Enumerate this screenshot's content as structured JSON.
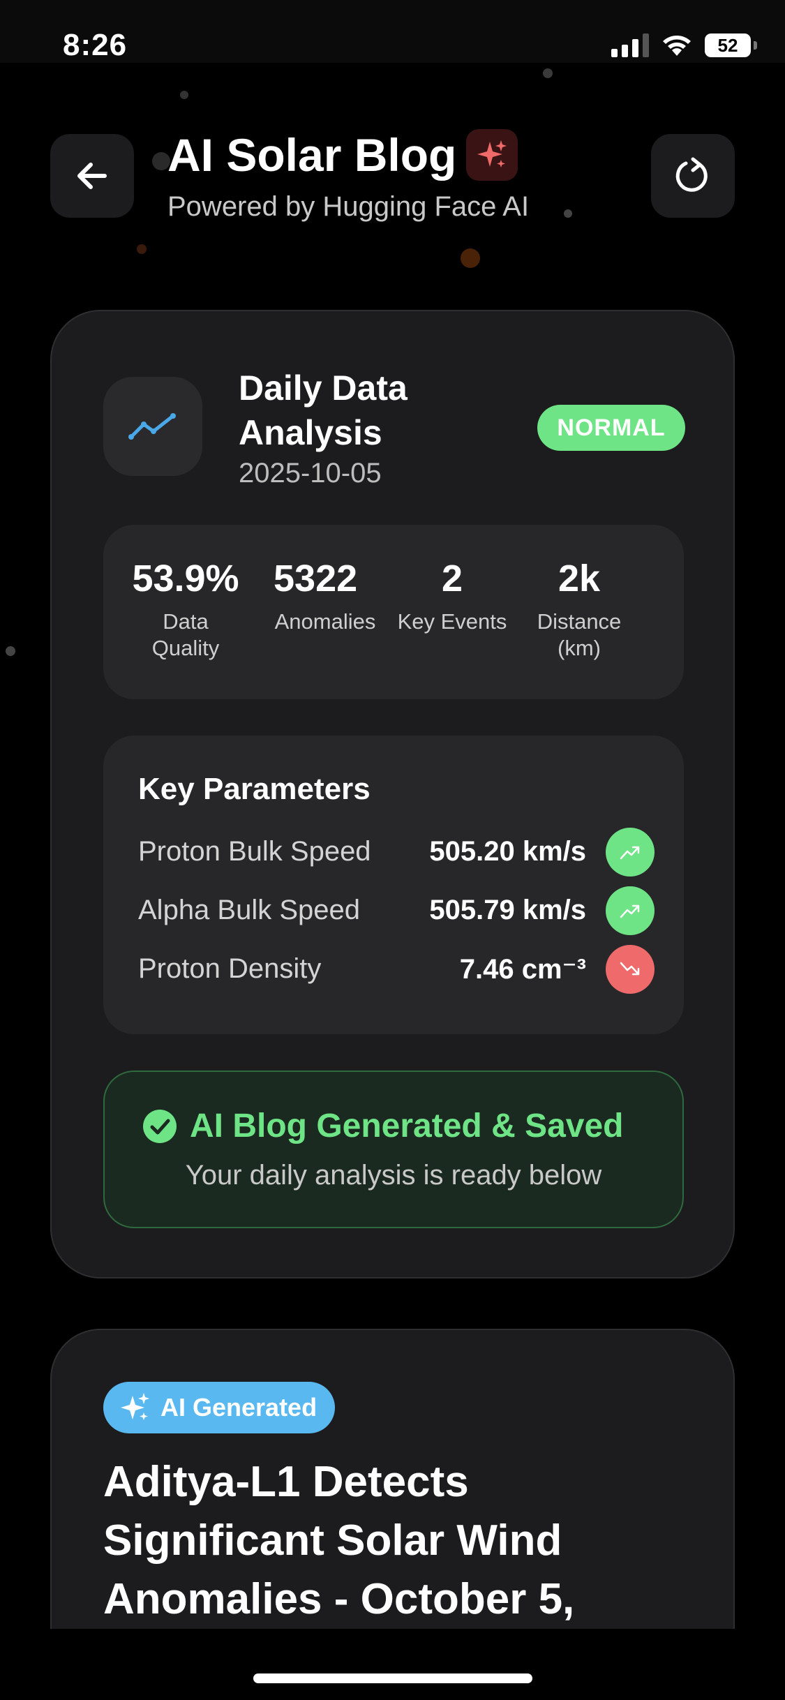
{
  "status_bar": {
    "time": "8:26",
    "battery": "52"
  },
  "header": {
    "title": "AI Solar Blog",
    "subtitle": "Powered by Hugging Face AI",
    "icons": {
      "back": "arrow-left-icon",
      "refresh": "refresh-icon",
      "sparkle": "sparkles-icon"
    }
  },
  "analysis": {
    "title": "Daily Data Analysis",
    "date": "2025-10-05",
    "status": "NORMAL",
    "stats": [
      {
        "value": "53.9%",
        "label": "Data Quality"
      },
      {
        "value": "5322",
        "label": "Anomalies"
      },
      {
        "value": "2",
        "label": "Key Events"
      },
      {
        "value": "2k",
        "label": "Distance (km)"
      }
    ],
    "key_parameters": {
      "title": "Key Parameters",
      "rows": [
        {
          "name": "Proton Bulk Speed",
          "value": "505.20 km/s",
          "trend": "up"
        },
        {
          "name": "Alpha Bulk Speed",
          "value": "505.79 km/s",
          "trend": "up"
        },
        {
          "name": "Proton Density",
          "value": "7.46 cm⁻³",
          "trend": "down"
        }
      ]
    },
    "success": {
      "title": "AI Blog Generated & Saved",
      "subtitle": "Your daily analysis is ready below"
    }
  },
  "blog": {
    "badge": "AI Generated",
    "title": "Aditya-L1 Detects Significant Solar Wind Anomalies - October 5,"
  },
  "colors": {
    "background": "#000000",
    "card": "#1c1c1e",
    "success_green": "#6ee486",
    "down_red": "#ef6b6b",
    "ai_blue": "#5ab8f0",
    "chart_icon_blue": "#4aa8e8"
  }
}
